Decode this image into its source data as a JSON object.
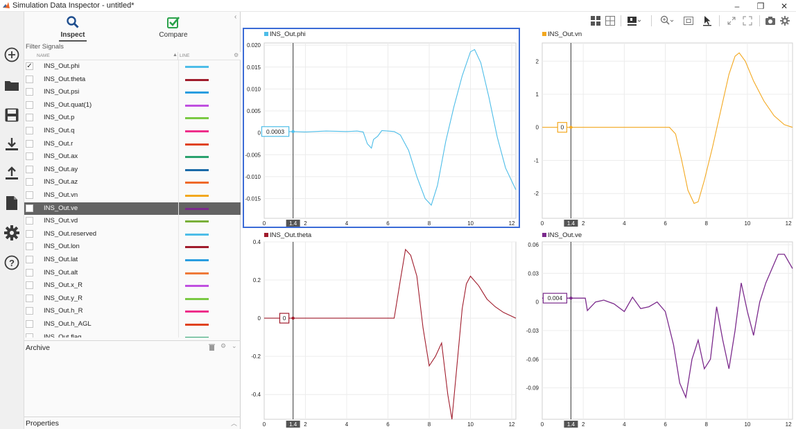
{
  "window": {
    "title": "Simulation Data Inspector - untitled*",
    "min": "–",
    "restore": "❐",
    "close": "✕"
  },
  "left_toolbar": [
    {
      "name": "new-session-icon",
      "glyph": "⊕"
    },
    {
      "name": "open-folder-icon",
      "glyph": "folder"
    },
    {
      "name": "save-icon",
      "glyph": "save"
    },
    {
      "name": "import-icon",
      "glyph": "download"
    },
    {
      "name": "export-icon",
      "glyph": "upload"
    },
    {
      "name": "report-icon",
      "glyph": "document"
    },
    {
      "name": "preferences-icon",
      "glyph": "gear"
    },
    {
      "name": "help-icon",
      "glyph": "?"
    }
  ],
  "tabs": [
    {
      "label": "Inspect",
      "active": true,
      "icon": "search-icon"
    },
    {
      "label": "Compare",
      "active": false,
      "icon": "check-icon"
    }
  ],
  "filter": {
    "placeholder": "Filter Signals"
  },
  "columns": {
    "name": "NAME",
    "line": "LINE"
  },
  "signals": [
    {
      "name": "INS_Out.phi",
      "color": "#4dbde8",
      "checked": true,
      "selected": false
    },
    {
      "name": "INS_Out.theta",
      "color": "#a01c2c",
      "checked": false,
      "selected": false
    },
    {
      "name": "INS_Out.psi",
      "color": "#2a9de0",
      "checked": false,
      "selected": false
    },
    {
      "name": "INS_Out.quat(1)",
      "color": "#c050e0",
      "checked": false,
      "selected": false
    },
    {
      "name": "INS_Out.p",
      "color": "#7ac943",
      "checked": false,
      "selected": false
    },
    {
      "name": "INS_Out.q",
      "color": "#ee2e8a",
      "checked": false,
      "selected": false
    },
    {
      "name": "INS_Out.r",
      "color": "#e0421e",
      "checked": false,
      "selected": false
    },
    {
      "name": "INS_Out.ax",
      "color": "#2aa26e",
      "checked": false,
      "selected": false
    },
    {
      "name": "INS_Out.ay",
      "color": "#1b6aa8",
      "checked": false,
      "selected": false
    },
    {
      "name": "INS_Out.az",
      "color": "#ef6a2a",
      "checked": false,
      "selected": false
    },
    {
      "name": "INS_Out.vn",
      "color": "#f3a81f",
      "checked": false,
      "selected": false
    },
    {
      "name": "INS_Out.ve",
      "color": "#7b2a8c",
      "checked": true,
      "selected": true
    },
    {
      "name": "INS_Out.vd",
      "color": "#7ab03a",
      "checked": false,
      "selected": false
    },
    {
      "name": "INS_Out.reserved",
      "color": "#4dbde8",
      "checked": false,
      "selected": false
    },
    {
      "name": "INS_Out.lon",
      "color": "#a01c2c",
      "checked": false,
      "selected": false
    },
    {
      "name": "INS_Out.lat",
      "color": "#2a9de0",
      "checked": false,
      "selected": false
    },
    {
      "name": "INS_Out.alt",
      "color": "#ef7a3a",
      "checked": false,
      "selected": false
    },
    {
      "name": "INS_Out.x_R",
      "color": "#c050e0",
      "checked": false,
      "selected": false
    },
    {
      "name": "INS_Out.y_R",
      "color": "#7ac943",
      "checked": false,
      "selected": false
    },
    {
      "name": "INS_Out.h_R",
      "color": "#ee2e8a",
      "checked": false,
      "selected": false
    },
    {
      "name": "INS_Out.h_AGL",
      "color": "#e0421e",
      "checked": false,
      "selected": false
    },
    {
      "name": "INS_Out.flag",
      "color": "#2aa26e",
      "checked": false,
      "selected": false
    }
  ],
  "archive_label": "Archive",
  "properties_label": "Properties",
  "cursor_time": "1.4",
  "chart_data": [
    {
      "type": "line",
      "title": "INS_Out.phi",
      "color": "#4dbde8",
      "active": true,
      "xlim": [
        0,
        12.2
      ],
      "ylim": [
        -0.0195,
        0.0205
      ],
      "xticks": [
        0,
        2,
        4,
        6,
        8,
        10,
        12
      ],
      "yticks": [
        0.02,
        0.015,
        0.01,
        0.005,
        0,
        -0.005,
        -0.01,
        -0.015
      ],
      "ytick_labels": [
        "0.020",
        "0.015",
        "0.010",
        "0.005",
        "0",
        "-0.005",
        "-0.010",
        "-0.015"
      ],
      "cursor_value": "0.0003",
      "x": [
        0,
        1.4,
        2,
        3,
        4,
        4.5,
        4.8,
        5.0,
        5.2,
        5.3,
        5.5,
        5.7,
        6.0,
        6.3,
        6.6,
        7.0,
        7.4,
        7.8,
        8.1,
        8.4,
        8.8,
        9.2,
        9.6,
        10.0,
        10.2,
        10.5,
        10.9,
        11.3,
        11.7,
        12.2
      ],
      "y": [
        0.0003,
        0.0003,
        0.0002,
        0.0004,
        0.0003,
        0.0004,
        0.0002,
        -0.0025,
        -0.0035,
        -0.0015,
        -0.0008,
        0.0005,
        0.0004,
        0.0003,
        -0.0005,
        -0.004,
        -0.01,
        -0.015,
        -0.0165,
        -0.012,
        -0.002,
        0.006,
        0.013,
        0.0185,
        0.019,
        0.016,
        0.008,
        -0.001,
        -0.008,
        -0.013
      ]
    },
    {
      "type": "line",
      "title": "INS_Out.vn",
      "color": "#f3a81f",
      "active": false,
      "xlim": [
        0,
        12.2
      ],
      "ylim": [
        -2.75,
        2.55
      ],
      "xticks": [
        0,
        2,
        4,
        6,
        8,
        10,
        12
      ],
      "yticks": [
        2,
        1,
        0,
        -1,
        -2
      ],
      "ytick_labels": [
        "2",
        "1",
        "0",
        "-1",
        "-2"
      ],
      "cursor_value": "0",
      "x": [
        0,
        1.4,
        3,
        5,
        6.2,
        6.5,
        6.8,
        7.1,
        7.4,
        7.6,
        7.9,
        8.3,
        8.7,
        9.1,
        9.4,
        9.6,
        9.9,
        10.3,
        10.8,
        11.3,
        11.8,
        12.2
      ],
      "y": [
        0,
        0,
        0,
        0,
        0,
        -0.2,
        -1.0,
        -1.9,
        -2.3,
        -2.25,
        -1.6,
        -0.6,
        0.5,
        1.6,
        2.15,
        2.25,
        2.0,
        1.4,
        0.8,
        0.35,
        0.08,
        0
      ]
    },
    {
      "type": "line",
      "title": "INS_Out.theta",
      "color": "#a01c2c",
      "active": false,
      "xlim": [
        0,
        12.2
      ],
      "ylim": [
        -0.53,
        0.4
      ],
      "xticks": [
        0,
        2,
        4,
        6,
        8,
        10,
        12
      ],
      "yticks": [
        0.4,
        0.2,
        0,
        -0.2,
        -0.4
      ],
      "ytick_labels": [
        "0.4",
        "0.2",
        "0",
        "-0.2",
        "-0.4"
      ],
      "cursor_value": "0",
      "x": [
        0,
        1.4,
        3,
        5,
        6.3,
        6.6,
        6.85,
        7.1,
        7.4,
        7.7,
        8.0,
        8.3,
        8.6,
        8.9,
        9.1,
        9.3,
        9.6,
        9.8,
        10.0,
        10.4,
        10.8,
        11.2,
        11.6,
        12.2
      ],
      "y": [
        0,
        0,
        0,
        0,
        0,
        0.2,
        0.36,
        0.33,
        0.22,
        -0.05,
        -0.25,
        -0.2,
        -0.13,
        -0.4,
        -0.53,
        -0.3,
        0.05,
        0.18,
        0.22,
        0.17,
        0.1,
        0.06,
        0.03,
        0
      ]
    },
    {
      "type": "line",
      "title": "INS_Out.ve",
      "color": "#7b2a8c",
      "active": false,
      "xlim": [
        0,
        12.2
      ],
      "ylim": [
        -0.123,
        0.063
      ],
      "xticks": [
        0,
        2,
        4,
        6,
        8,
        10,
        12
      ],
      "yticks": [
        0.06,
        0.03,
        0,
        -0.03,
        -0.06,
        -0.09
      ],
      "ytick_labels": [
        "0.06",
        "0.03",
        "0",
        "-0.03",
        "-0.06",
        "-0.09"
      ],
      "cursor_value": "0.004",
      "x": [
        0,
        1.4,
        2.1,
        2.2,
        2.6,
        3.0,
        3.5,
        4.0,
        4.4,
        4.8,
        5.2,
        5.6,
        6.0,
        6.4,
        6.7,
        7.0,
        7.3,
        7.6,
        7.9,
        8.2,
        8.5,
        8.8,
        9.1,
        9.4,
        9.7,
        10.0,
        10.3,
        10.6,
        10.9,
        11.2,
        11.5,
        11.8,
        12.2
      ],
      "y": [
        0.004,
        0.004,
        0.004,
        -0.009,
        0.0,
        0.002,
        -0.002,
        -0.01,
        0.005,
        -0.007,
        -0.005,
        0.0,
        -0.01,
        -0.045,
        -0.085,
        -0.1,
        -0.06,
        -0.04,
        -0.07,
        -0.06,
        -0.005,
        -0.04,
        -0.07,
        -0.03,
        0.02,
        -0.01,
        -0.035,
        0.0,
        0.02,
        0.035,
        0.05,
        0.05,
        0.035
      ]
    }
  ]
}
